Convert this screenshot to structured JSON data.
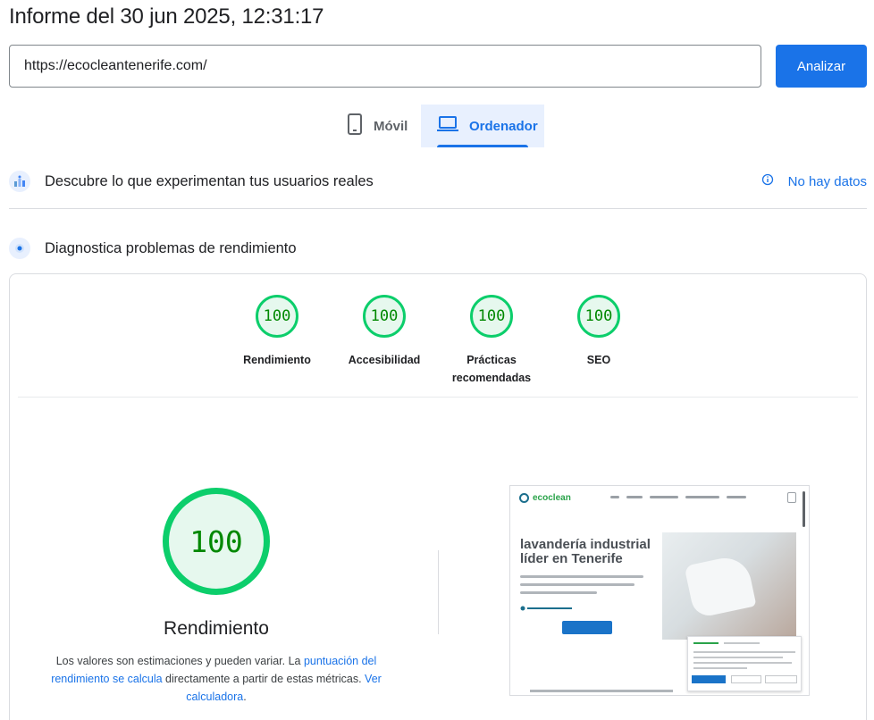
{
  "header": {
    "title": "Informe del 30 jun 2025, 12:31:17"
  },
  "search": {
    "url_value": "https://ecocleantenerife.com/",
    "analyze_label": "Analizar"
  },
  "tabs": [
    {
      "label": "Móvil",
      "icon": "smartphone-icon",
      "active": false
    },
    {
      "label": "Ordenador",
      "icon": "laptop-icon",
      "active": true
    }
  ],
  "crux": {
    "title": "Descubre lo que experimentan tus usuarios reales",
    "status": "No hay datos"
  },
  "diagnose": {
    "title": "Diagnostica problemas de rendimiento"
  },
  "scores": [
    {
      "value": "100",
      "label": "Rendimiento"
    },
    {
      "value": "100",
      "label": "Accesibilidad"
    },
    {
      "value": "100",
      "label": "Prácticas recomendadas"
    },
    {
      "value": "100",
      "label": "SEO"
    }
  ],
  "performance": {
    "value": "100",
    "label": "Rendimiento",
    "desc_prefix": "Los valores son estimaciones y pueden variar. La ",
    "desc_link1": "puntuación del rendimiento se calcula",
    "desc_middle": " directamente a partir de estas métricas. ",
    "desc_link2": "Ver calculadora",
    "desc_suffix": "."
  },
  "preview": {
    "logo": "ecoclean",
    "headline_1": "lavandería industrial",
    "headline_2": "líder en Tenerife"
  },
  "colors": {
    "accent": "#1a73e8",
    "pass": "#0cce6b",
    "pass_text": "#008800",
    "pass_bg": "#e6f8ee"
  }
}
